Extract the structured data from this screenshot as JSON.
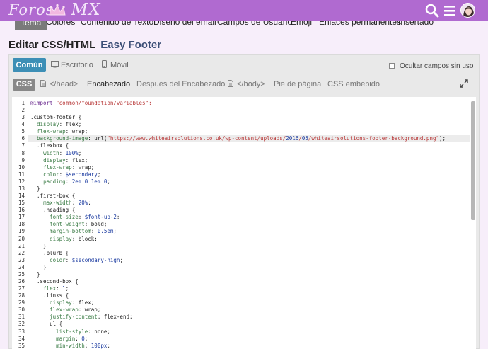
{
  "header": {
    "logo_text_1": "Foros",
    "logo_text_2": "MX",
    "colors": {
      "bar": "#b06ad0",
      "accent": "#3d8fb6"
    }
  },
  "nav": {
    "tabs": [
      "Tema",
      "Colores",
      "Contenido de Texto",
      "Diseño del email",
      "Campos de Usuario",
      "Emoji",
      "Enlaces permanentes",
      "Insertado"
    ]
  },
  "page": {
    "title": "Editar CSS/HTML",
    "theme_name": "Easy Footer"
  },
  "modes": {
    "comun": "Común",
    "escritorio": "Escritorio",
    "movil": "Móvil",
    "hide_fields": "Ocultar campos sin uso"
  },
  "file_tabs": {
    "css": "CSS",
    "head": "</head>",
    "header": "Encabezado",
    "after_header": "Después del Encabezado",
    "body": "</body>",
    "footer": "Pie de página",
    "embedded": "CSS embebido"
  },
  "code_lines": [
    "@import \"common/foundation/variables\";",
    "",
    ".custom-footer {",
    "  display: flex;",
    "  flex-wrap: wrap;",
    "  background-image: url(\"https://www.whiteairsolutions.co.uk/wp-content/uploads/2016/05/whiteairsolutions-footer-background.png\");",
    "  .flexbox {",
    "    width: 100%;",
    "    display: flex;",
    "    flex-wrap: wrap;",
    "    color: $secondary;",
    "    padding: 2em 0 1em 0;",
    "  }",
    "  .first-box {",
    "    max-width: 20%;",
    "    .heading {",
    "      font-size: $font-up-2;",
    "      font-weight: bold;",
    "      margin-bottom: 0.5em;",
    "      display: block;",
    "    }",
    "    .blurb {",
    "      color: $secondary-high;",
    "    }",
    "  }",
    "  .second-box {",
    "    flex: 1;",
    "    .links {",
    "      display: flex;",
    "      flex-wrap: wrap;",
    "      justify-content: flex-end;",
    "      ul {",
    "        list-style: none;",
    "        margin: 0;",
    "        min-width: 100px;"
  ],
  "line_numbers": [
    "1",
    "2",
    "3",
    "4",
    "5",
    "6",
    "7",
    "8",
    "9",
    "10",
    "11",
    "12",
    "13",
    "14",
    "15",
    "16",
    "17",
    "18",
    "19",
    "20",
    "21",
    "22",
    "23",
    "24",
    "25",
    "26",
    "27",
    "28",
    "29",
    "30",
    "31",
    "32",
    "33",
    "34",
    "35"
  ]
}
